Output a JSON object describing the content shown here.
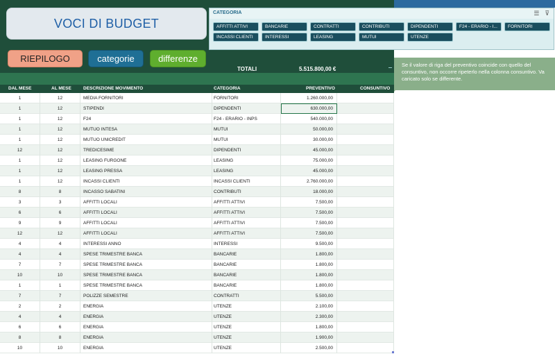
{
  "title": "VOCI DI BUDGET",
  "nav": {
    "riepilogo": "RIEPILOGO",
    "categorie": "categorie",
    "differenze": "differenze"
  },
  "total": {
    "label": "TOTALI",
    "value": "5.515.800,00 €"
  },
  "slicer": {
    "title": "CATEGORIA",
    "items": [
      "AFFITTI ATTIVI",
      "BANCARIE",
      "CONTRATTI",
      "CONTRIBUTI",
      "DIPENDENTI",
      "F24 - ERARIO - I...",
      "FORNITORI",
      "INCASSI CLIENTI",
      "INTERESSI",
      "LEASING",
      "MUTUI",
      "UTENZE"
    ],
    "icons": [
      "multi-select-icon",
      "clear-filter-icon"
    ]
  },
  "note": "Se il valore di riga del preventivo coincide con quello del consuntivo, non occorre ripeterlo nella colonna consuntivo. Va caricato solo se differente.",
  "columns": {
    "dal": "DAL MESE",
    "al": "AL MESE",
    "desc": "DESCRIZIONE MOVIMENTO",
    "cat": "CATEGORIA",
    "prev": "PREVENTIVO",
    "cons": "CONSUNTIVO"
  },
  "rows": [
    {
      "dal": "1",
      "al": "12",
      "desc": "MEDIA FORNITORI",
      "cat": "FORNITORI",
      "prev": "1.260.000,00"
    },
    {
      "dal": "1",
      "al": "12",
      "desc": "STIPENDI",
      "cat": "DIPENDENTI",
      "prev": "630.000,00"
    },
    {
      "dal": "1",
      "al": "12",
      "desc": "F24",
      "cat": "F24 - ERARIO - INPS",
      "prev": "540.000,00"
    },
    {
      "dal": "1",
      "al": "12",
      "desc": "MUTUO INTESA",
      "cat": "MUTUI",
      "prev": "50.000,00"
    },
    {
      "dal": "1",
      "al": "12",
      "desc": "MUTUO UNICREDIT",
      "cat": "MUTUI",
      "prev": "30.000,00"
    },
    {
      "dal": "12",
      "al": "12",
      "desc": "TREDICESIME",
      "cat": "DIPENDENTI",
      "prev": "45.000,00"
    },
    {
      "dal": "1",
      "al": "12",
      "desc": "LEASING FURGONE",
      "cat": "LEASING",
      "prev": "75.000,00"
    },
    {
      "dal": "1",
      "al": "12",
      "desc": "LEASING PRESSA",
      "cat": "LEASING",
      "prev": "45.000,00"
    },
    {
      "dal": "1",
      "al": "12",
      "desc": "INCASSI CLIENTI",
      "cat": "INCASSI CLIENTI",
      "prev": "2.760.000,00"
    },
    {
      "dal": "8",
      "al": "8",
      "desc": "INCASSO SABATINI",
      "cat": "CONTRIBUTI",
      "prev": "18.000,00"
    },
    {
      "dal": "3",
      "al": "3",
      "desc": "AFFITTI LOCALI",
      "cat": "AFFITTI ATTIVI",
      "prev": "7.500,00"
    },
    {
      "dal": "6",
      "al": "6",
      "desc": "AFFITTI LOCALI",
      "cat": "AFFITTI ATTIVI",
      "prev": "7.500,00"
    },
    {
      "dal": "9",
      "al": "9",
      "desc": "AFFITTI LOCALI",
      "cat": "AFFITTI ATTIVI",
      "prev": "7.500,00"
    },
    {
      "dal": "12",
      "al": "12",
      "desc": "AFFITTI LOCALI",
      "cat": "AFFITTI ATTIVI",
      "prev": "7.500,00"
    },
    {
      "dal": "4",
      "al": "4",
      "desc": "INTERESSI ANNO",
      "cat": "INTERESSI",
      "prev": "9.500,00"
    },
    {
      "dal": "4",
      "al": "4",
      "desc": "SPESE TRIMESTRE BANCA",
      "cat": "BANCARIE",
      "prev": "1.800,00"
    },
    {
      "dal": "7",
      "al": "7",
      "desc": "SPESE TRIMESTRE BANCA",
      "cat": "BANCARIE",
      "prev": "1.800,00"
    },
    {
      "dal": "10",
      "al": "10",
      "desc": "SPESE TRIMESTRE BANCA",
      "cat": "BANCARIE",
      "prev": "1.800,00"
    },
    {
      "dal": "1",
      "al": "1",
      "desc": "SPESE TRIMESTRE BANCA",
      "cat": "BANCARIE",
      "prev": "1.800,00"
    },
    {
      "dal": "7",
      "al": "7",
      "desc": "POLIZZE SEMESTRE",
      "cat": "CONTRATTI",
      "prev": "5.500,00"
    },
    {
      "dal": "2",
      "al": "2",
      "desc": "ENERGIA",
      "cat": "UTENZE",
      "prev": "2.100,00"
    },
    {
      "dal": "4",
      "al": "4",
      "desc": "ENERGIA",
      "cat": "UTENZE",
      "prev": "2.300,00"
    },
    {
      "dal": "6",
      "al": "6",
      "desc": "ENERGIA",
      "cat": "UTENZE",
      "prev": "1.800,00"
    },
    {
      "dal": "8",
      "al": "8",
      "desc": "ENERGIA",
      "cat": "UTENZE",
      "prev": "1.900,00"
    },
    {
      "dal": "10",
      "al": "10",
      "desc": "ENERGIA",
      "cat": "UTENZE",
      "prev": "2.500,00"
    }
  ]
}
